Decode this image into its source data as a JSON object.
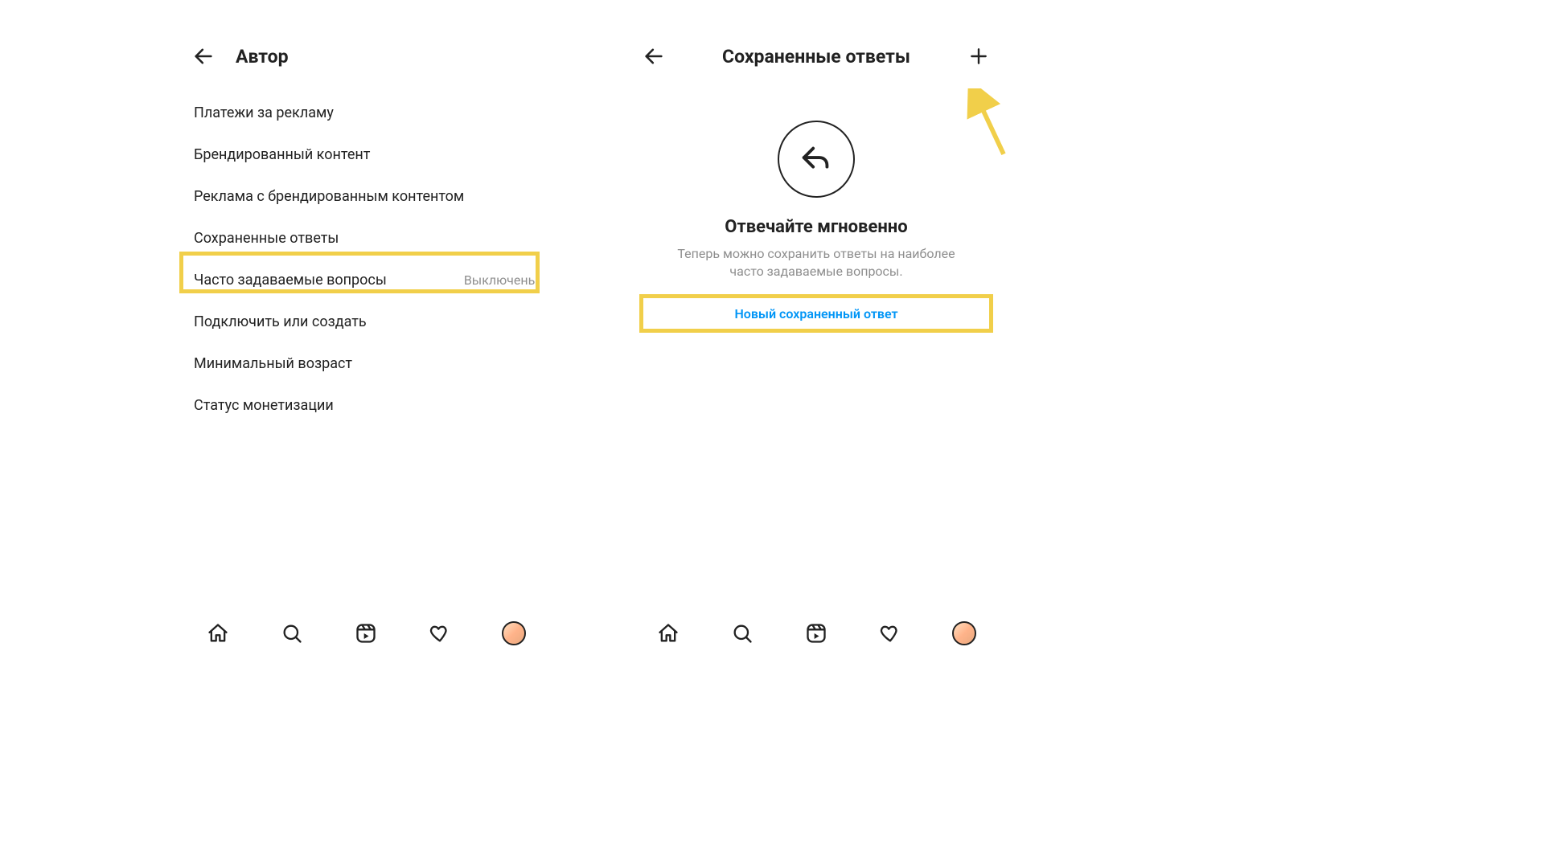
{
  "left": {
    "title": "Автор",
    "items": [
      {
        "label": "Платежи за рекламу"
      },
      {
        "label": "Брендированный контент"
      },
      {
        "label": "Реклама с брендированным контентом"
      },
      {
        "label": "Сохраненные ответы"
      },
      {
        "label": "Часто задаваемые вопросы",
        "status": "Выключены"
      },
      {
        "label": "Подключить или создать"
      },
      {
        "label": "Минимальный возраст"
      },
      {
        "label": "Статус монетизации"
      }
    ]
  },
  "right": {
    "title": "Сохраненные ответы",
    "empty_title": "Отвечайте мгновенно",
    "empty_body": "Теперь можно сохранить ответы на наиболее часто задаваемые вопросы.",
    "new_reply_label": "Новый сохраненный ответ"
  },
  "annotations": {
    "highlight_color": "#f1cf4a",
    "link_color": "#0095f6",
    "arrow_points_to": "add-saved-reply-button"
  },
  "navbar": {
    "items": [
      "home",
      "search",
      "reels",
      "activity",
      "profile"
    ]
  }
}
